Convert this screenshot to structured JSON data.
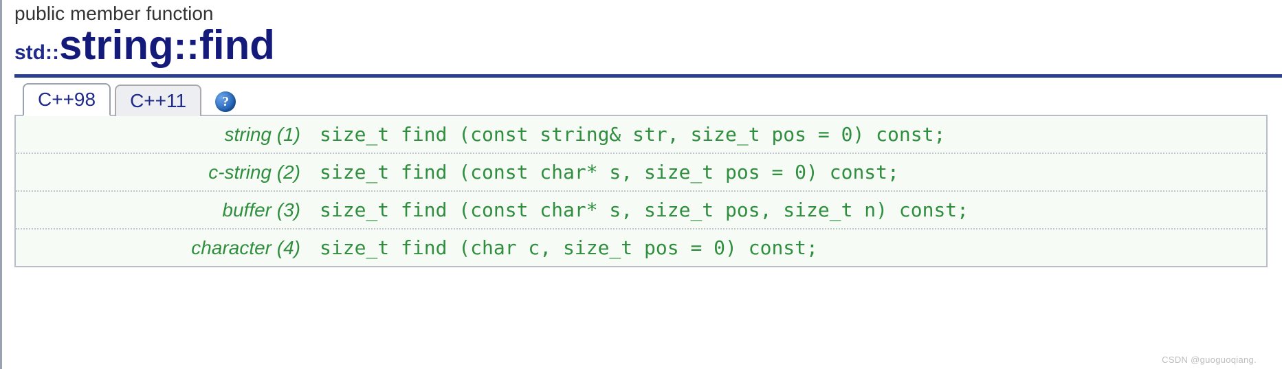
{
  "header": {
    "category": "public member function",
    "namespace": "std::",
    "class": "string",
    "separator": "::",
    "member": "find"
  },
  "tabs": {
    "items": [
      {
        "label": "C++98",
        "active": true
      },
      {
        "label": "C++11",
        "active": false
      }
    ],
    "help_symbol": "?"
  },
  "prototypes": [
    {
      "name": "string (1)",
      "signature": "size_t find (const string& str, size_t pos = 0) const;"
    },
    {
      "name": "c-string (2)",
      "signature": "size_t find (const char* s, size_t pos = 0) const;"
    },
    {
      "name": "buffer (3)",
      "signature": "size_t find (const char* s, size_t pos, size_t n) const;"
    },
    {
      "name": "character (4)",
      "signature": "size_t find (char c, size_t pos = 0) const;"
    }
  ],
  "watermark": "CSDN @guoguoqiang."
}
